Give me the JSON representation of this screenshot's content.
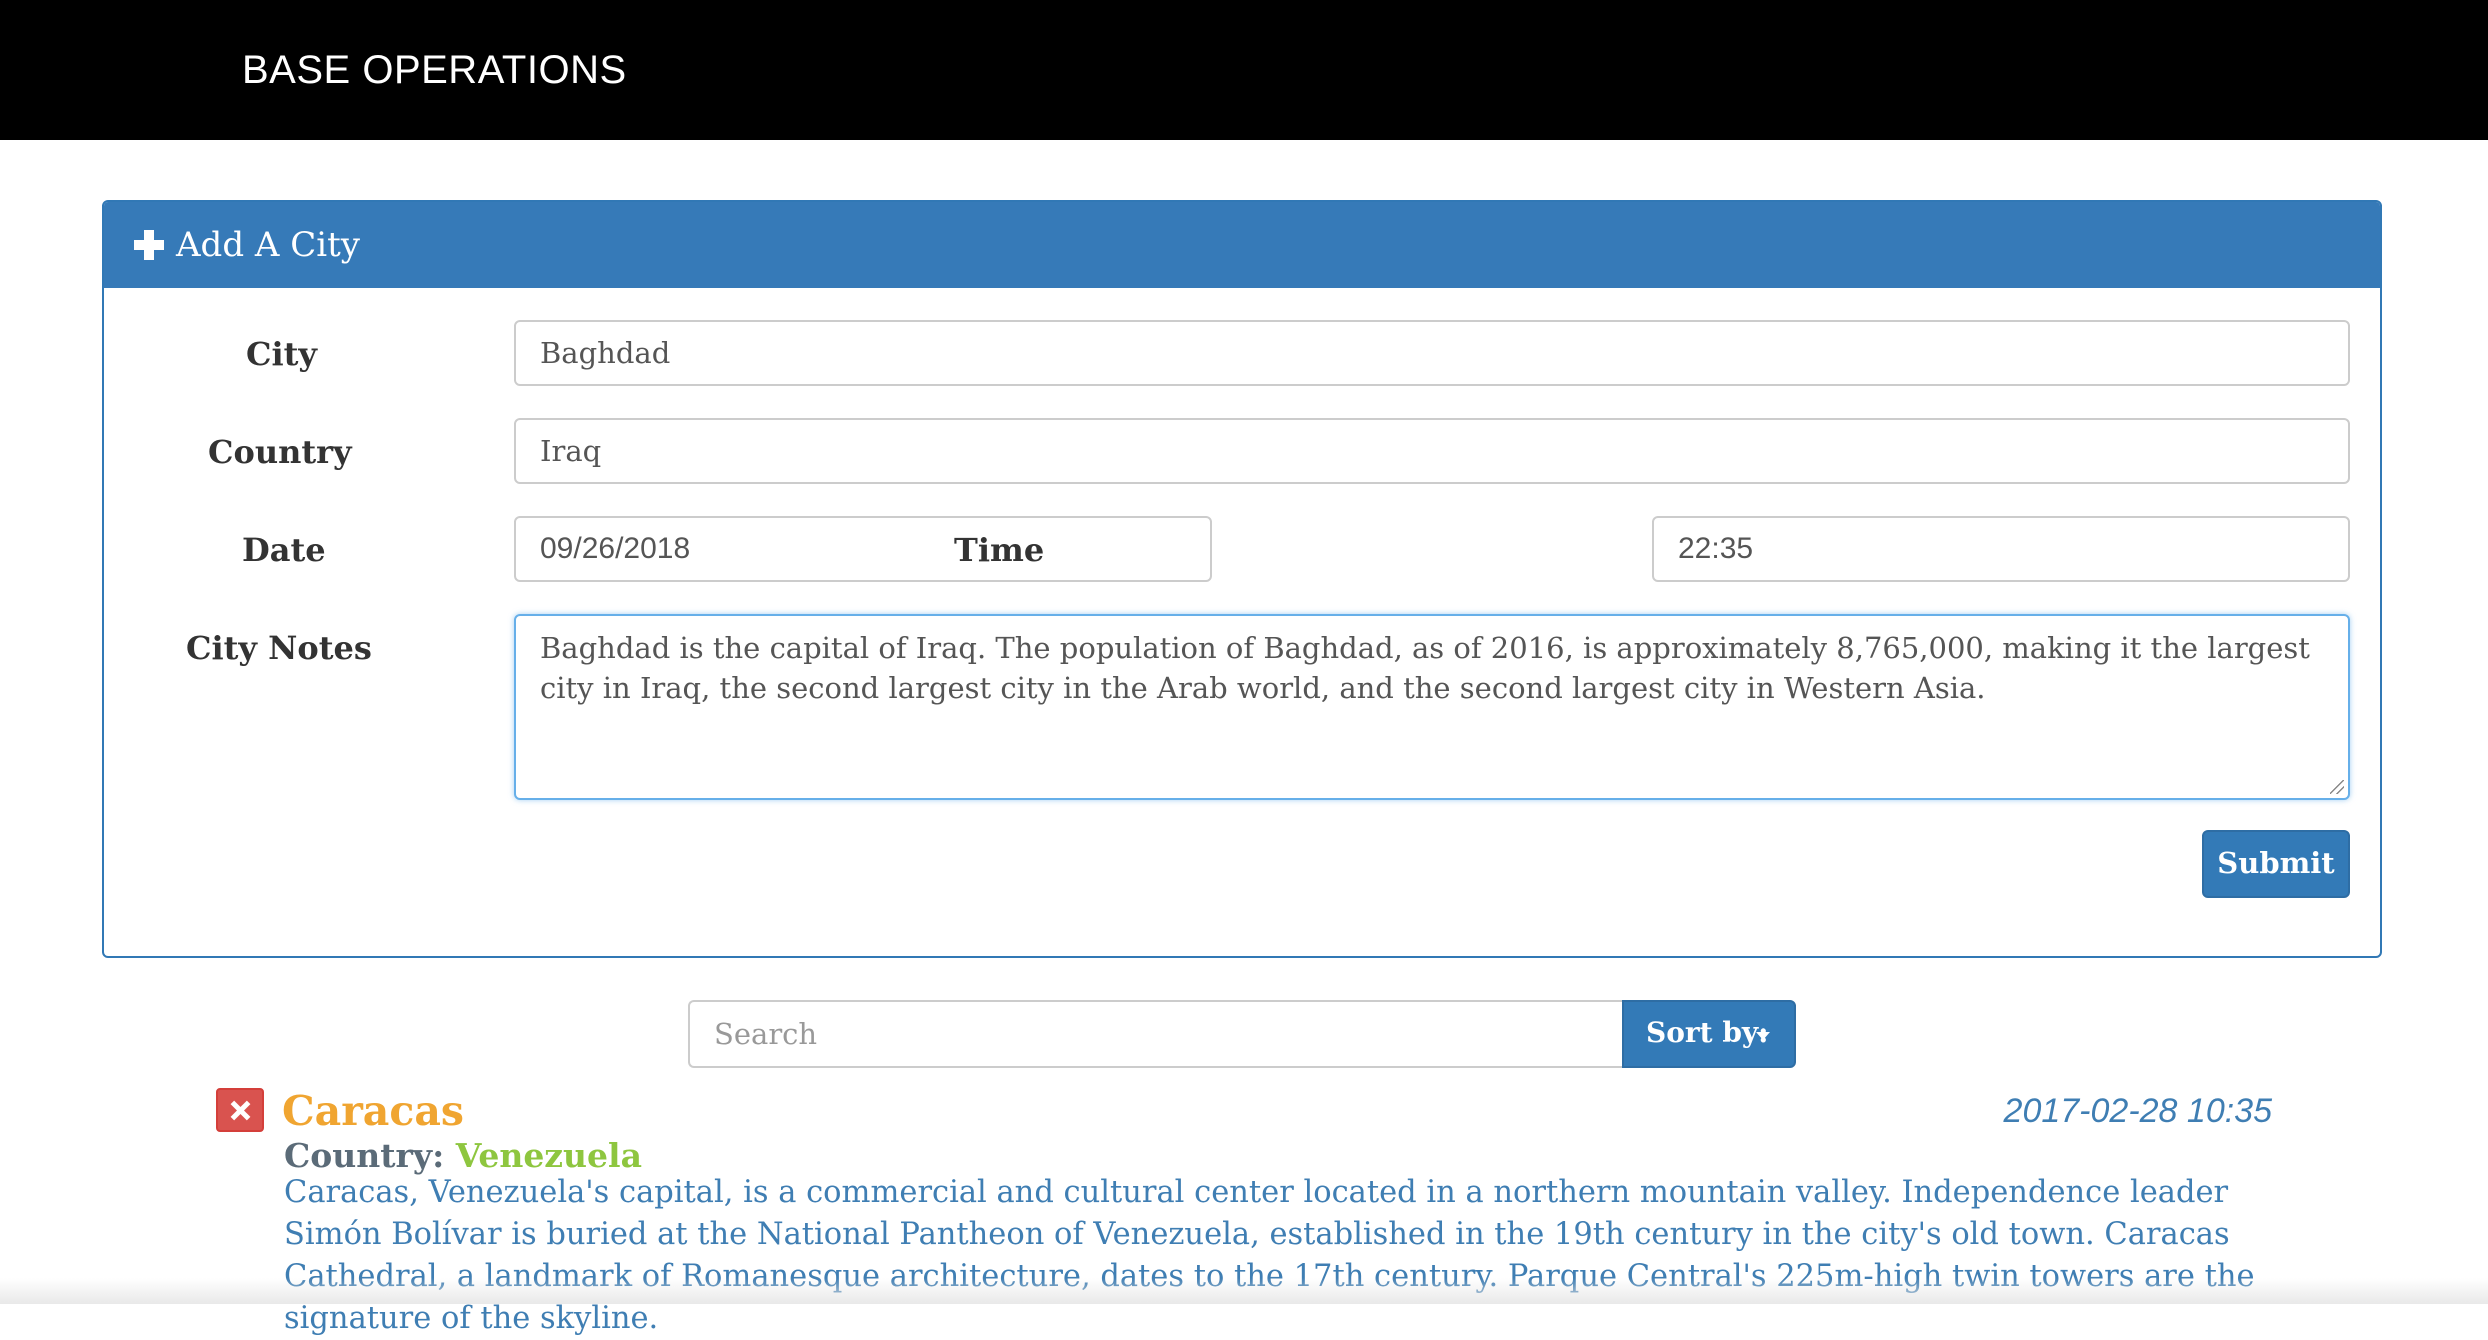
{
  "header": {
    "brand": "BASE OPERATIONS"
  },
  "form": {
    "title": "Add A City",
    "icon": "plus-icon",
    "city_label": "City",
    "city_value": "Baghdad",
    "country_label": "Country",
    "country_value": "Iraq",
    "date_label": "Date",
    "date_value": "09/26/2018",
    "time_label": "Time",
    "time_value": "22:35",
    "notes_label": "City Notes",
    "notes_value": "Baghdad is the capital of Iraq. The population of Baghdad, as of 2016, is approximately 8,765,000, making it the largest city in Iraq, the second largest city in the Arab world, and the second largest city in Western Asia.",
    "submit_label": "Submit"
  },
  "search": {
    "placeholder": "Search",
    "sort_label": "Sort by:"
  },
  "cities": [
    {
      "name": "Caracas",
      "country_label": "Country:",
      "country": "Venezuela",
      "datetime": "2017-02-28 10:35",
      "notes": "Caracas, Venezuela's capital, is a commercial and cultural center located in a northern mountain valley. Independence leader Simón Bolívar is buried at the National Pantheon of Venezuela, established in the 19th century in the city's old town. Caracas Cathedral, a landmark of Romanesque architecture, dates to the 17th century. Parque Central's 225m-high twin towers are the signature of the skyline."
    }
  ],
  "colors": {
    "navbar": "#000000",
    "primary": "#337ab7",
    "city_name": "#f0a531",
    "country_value": "#8ec63f",
    "notes_text": "#3f7eb3",
    "delete": "#d9534f"
  }
}
